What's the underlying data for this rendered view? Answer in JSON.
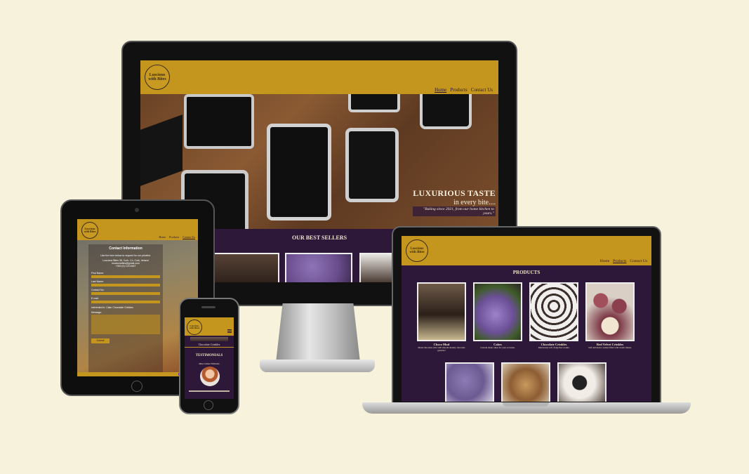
{
  "brand": {
    "logo_line1": "Luscious",
    "logo_line2": "with Bites"
  },
  "nav": {
    "home": "Home",
    "products": "Products",
    "contact": "Contact Us"
  },
  "hero": {
    "title": "LUXURIOUS TASTE",
    "subtitle": "in every bite....",
    "tagline": "\"Baking since 2021, from our home kitchen to yours.\""
  },
  "best_sellers": {
    "heading": "OUR BEST SELLERS"
  },
  "products": {
    "heading": "PRODUCTS",
    "items": [
      {
        "name": "Choco Mud",
        "desc": "Moist chocolate slice with smooth dreamy chocolate ganache!"
      },
      {
        "name": "Cakes",
        "desc": "Custom made cakes for your occasion."
      },
      {
        "name": "Chocolate Crinkles",
        "desc": "Deliciously soft, fudge like cookie."
      },
      {
        "name": "Red Velvet Crinkles",
        "desc": "Soft and moist cookies filled with cream cheese."
      }
    ]
  },
  "contact": {
    "heading": "Contact Information",
    "intro": "Use the form below to request for our pricelist.",
    "address": "Luscious Bites 35, Cork, Co. Cork, Ireland",
    "email": "lusciousbites@gmail.com",
    "phone": "+353 (0) 123 4567",
    "first_name": "First Name:",
    "last_name": "Last Name:",
    "contact_no": "Contact No:",
    "email_label": "E-mail:",
    "interest": "Interested in: Cake Chocolate Crinkles",
    "message": "Message:",
    "submit": "Submit"
  },
  "phone_view": {
    "product_caption": "Chocolate Crinkles",
    "testimonials_heading": "TESTIMONIALS",
    "reviewer": "Miss Jamie Williams"
  },
  "colors": {
    "gold": "#c4961e",
    "purple": "#2e1839",
    "cream_bg": "#f6f2dc"
  }
}
